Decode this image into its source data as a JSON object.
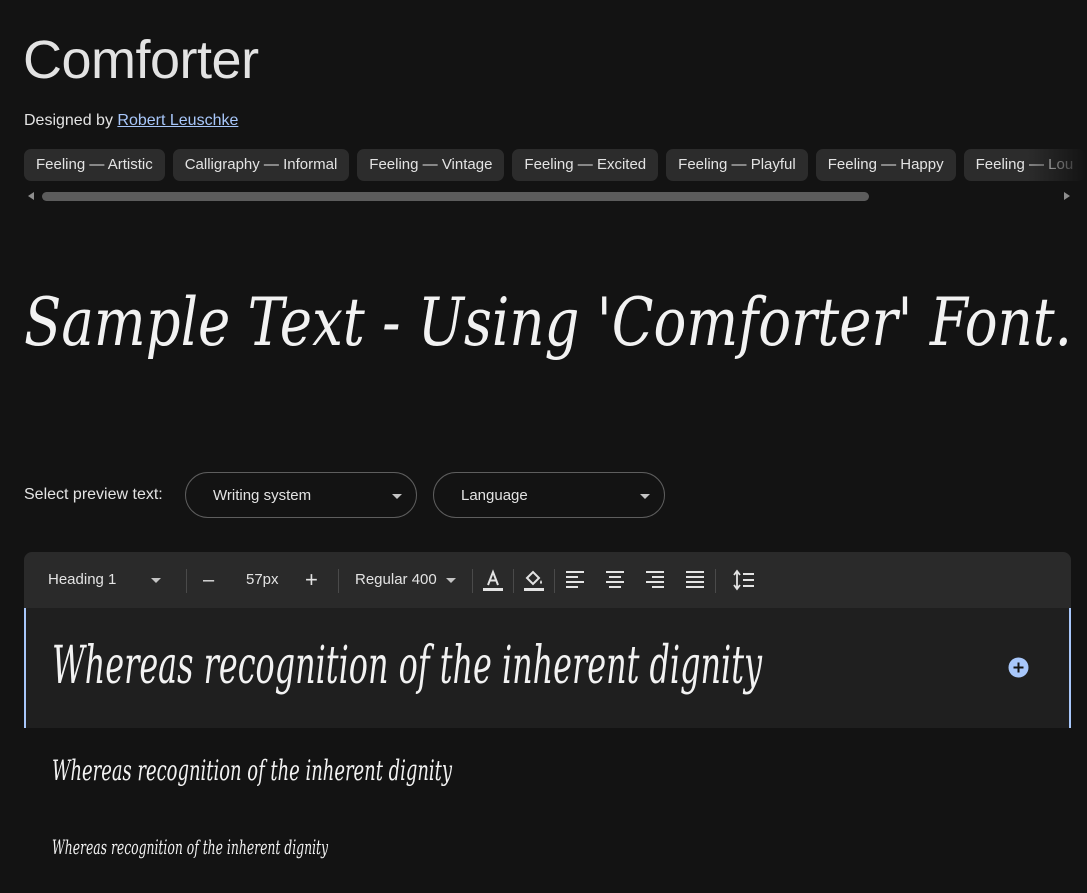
{
  "font": {
    "name": "Comforter",
    "designed_by_label": "Designed by",
    "designer": "Robert Leuschke"
  },
  "tags": [
    "Feeling — Artistic",
    "Calligraphy — Informal",
    "Feeling — Vintage",
    "Feeling — Excited",
    "Feeling — Playful",
    "Feeling — Happy",
    "Feeling — Lou"
  ],
  "sample_text": "Sample Text - Using 'Comforter' Font.",
  "preview_controls": {
    "label": "Select preview text:",
    "writing_system": "Writing system",
    "language": "Language"
  },
  "toolbar": {
    "style": "Heading 1",
    "decrease": "–",
    "size": "57px",
    "increase": "+",
    "weight": "Regular 400"
  },
  "preview_text": "Whereas recognition of the inherent dignity",
  "colors": {
    "background": "#131313",
    "accent": "#a8c7fa",
    "chip": "#2c2c2c",
    "toolbar": "#2a2a2a"
  },
  "icons": {
    "text_color": "text-color-icon",
    "fill": "fill-color-icon",
    "align_left": "align-left-icon",
    "align_center": "align-center-icon",
    "align_right": "align-right-icon",
    "align_justify": "align-justify-icon",
    "line_height": "line-height-icon",
    "add": "add-circle-icon"
  }
}
